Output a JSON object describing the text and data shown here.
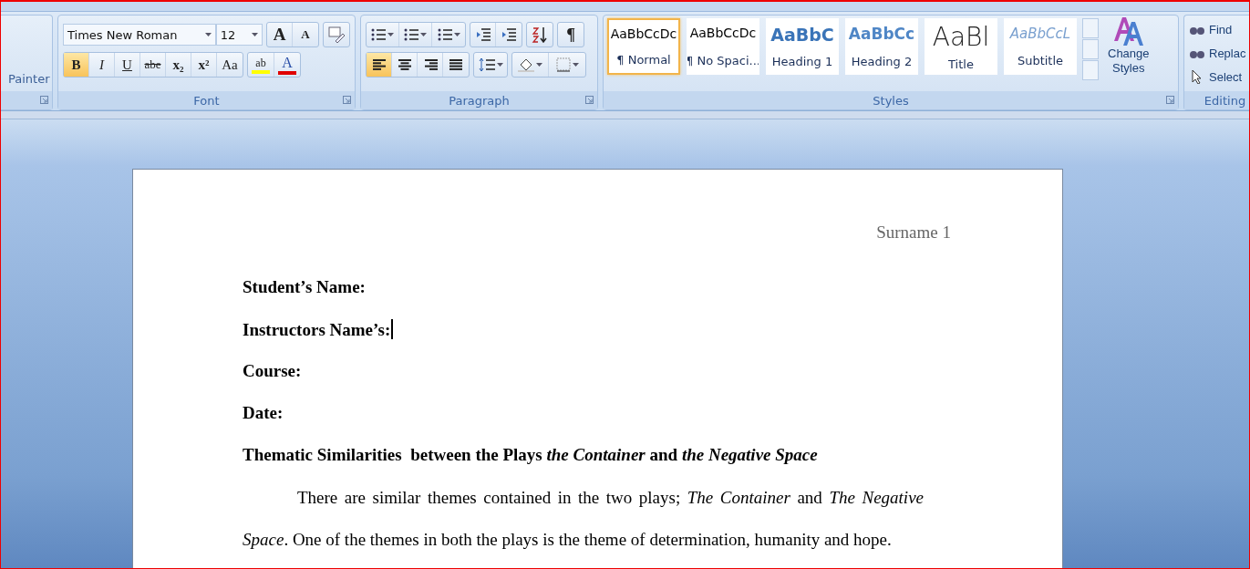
{
  "clipboard": {
    "format_painter": "Painter"
  },
  "font": {
    "label": "Font",
    "font_name": "Times New Roman",
    "font_size": "12",
    "grow": "A",
    "shrink": "A",
    "buttons": [
      {
        "kind": "bold",
        "glyph": "B",
        "selected": true
      },
      {
        "kind": "italic",
        "glyph": "I",
        "selected": false
      },
      {
        "kind": "underline",
        "glyph": "U",
        "selected": false
      },
      {
        "kind": "strike",
        "glyph": "abe",
        "selected": false
      },
      {
        "kind": "subscript",
        "glyph": "x₂",
        "selected": false
      },
      {
        "kind": "superscript",
        "glyph": "x²",
        "selected": false
      },
      {
        "kind": "case",
        "glyph": "Aa",
        "selected": false
      }
    ],
    "highlight": {
      "glyph": "ab",
      "color": "#ffff00"
    },
    "font_color": {
      "glyph": "A",
      "color": "#e00000"
    }
  },
  "paragraph": {
    "label": "Paragraph",
    "pilcrow": "¶",
    "alignments": [
      {
        "kind": "left",
        "selected": true
      },
      {
        "kind": "center",
        "selected": false
      },
      {
        "kind": "right",
        "selected": false
      },
      {
        "kind": "justify",
        "selected": false
      }
    ]
  },
  "styles": {
    "label": "Styles",
    "change_styles": [
      "Change",
      "Styles"
    ],
    "items": [
      {
        "kind": "normal",
        "preview": "AaBbCcDc",
        "name": "¶ Normal",
        "selected": true
      },
      {
        "kind": "nospacing",
        "preview": "AaBbCcDc",
        "name": "¶ No Spaci...",
        "selected": false
      },
      {
        "kind": "heading1",
        "preview": "AaBbC",
        "name": "Heading 1",
        "selected": false
      },
      {
        "kind": "heading2",
        "preview": "AaBbCc",
        "name": "Heading 2",
        "selected": false
      },
      {
        "kind": "title",
        "preview": "AaBl",
        "name": "Title",
        "selected": false
      },
      {
        "kind": "subtitle",
        "preview": "AaBbCcL",
        "name": "Subtitle",
        "selected": false
      }
    ]
  },
  "editing": {
    "label": "Editing",
    "items": [
      {
        "kind": "find",
        "label": "Find"
      },
      {
        "kind": "replace",
        "label": "Replac"
      },
      {
        "kind": "select",
        "label": "Select"
      }
    ]
  },
  "document": {
    "header": "Surname 1",
    "fields": [
      {
        "label": "Student’s Name:",
        "caret": false
      },
      {
        "label": "Instructors Name’s:",
        "caret": true
      },
      {
        "label": "Course:",
        "caret": false
      },
      {
        "label": "Date:",
        "caret": false
      }
    ],
    "title": "Thematic Similarities  between the Plays *the Container* and *the Negative Space*",
    "paragraph": "There are similar themes contained in the two plays; *The Container* and *The Negative Space*. One of the themes in both the plays is the theme of determination, humanity and hope."
  }
}
